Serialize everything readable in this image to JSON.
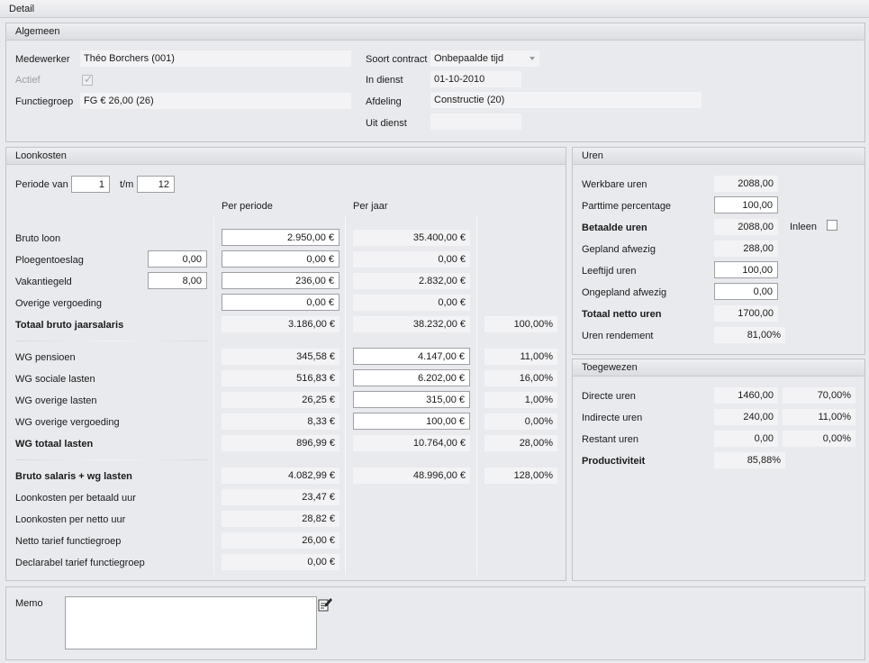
{
  "window": {
    "title": "Detail"
  },
  "algemeen": {
    "title": "Algemeen",
    "medewerker_label": "Medewerker",
    "medewerker_value": "Théo Borchers (001)",
    "actief_label": "Actief",
    "functiegroep_label": "Functiegroep",
    "functiegroep_value": "FG € 26,00 (26)",
    "soort_contract_label": "Soort contract",
    "soort_contract_value": "Onbepaalde tijd",
    "in_dienst_label": "In dienst",
    "in_dienst_value": "01-10-2010",
    "afdeling_label": "Afdeling",
    "afdeling_value": "Constructie (20)",
    "uit_dienst_label": "Uit dienst",
    "uit_dienst_value": ""
  },
  "loonkosten": {
    "title": "Loonkosten",
    "periode_van_label": "Periode van",
    "periode_van_value": "1",
    "tm_label": "t/m",
    "tm_value": "12",
    "col_per_periode": "Per periode",
    "col_per_jaar": "Per jaar",
    "bruto_loon": {
      "label": "Bruto loon",
      "periode": "2.950,00 €",
      "jaar": "35.400,00 €"
    },
    "ploegentoeslag": {
      "label": "Ploegentoeslag",
      "pct": "0,00",
      "periode": "0,00 €",
      "jaar": "0,00 €"
    },
    "vakantiegeld": {
      "label": "Vakantiegeld",
      "pct": "8,00",
      "periode": "236,00 €",
      "jaar": "2.832,00 €"
    },
    "overige_vergoeding": {
      "label": "Overige vergoeding",
      "periode": "0,00 €",
      "jaar": "0,00 €"
    },
    "totaal_bruto": {
      "label": "Totaal bruto jaarsalaris",
      "periode": "3.186,00 €",
      "jaar": "38.232,00 €",
      "pct": "100,00%"
    },
    "wg_pensioen": {
      "label": "WG pensioen",
      "periode": "345,58 €",
      "jaar": "4.147,00 €",
      "pct": "11,00%"
    },
    "wg_sociale": {
      "label": "WG sociale lasten",
      "periode": "516,83 €",
      "jaar": "6.202,00 €",
      "pct": "16,00%"
    },
    "wg_overige_lasten": {
      "label": "WG overige lasten",
      "periode": "26,25 €",
      "jaar": "315,00 €",
      "pct": "1,00%"
    },
    "wg_overige_verg": {
      "label": "WG overige vergoeding",
      "periode": "8,33 €",
      "jaar": "100,00 €",
      "pct": "0,00%"
    },
    "wg_totaal": {
      "label": "WG totaal lasten",
      "periode": "896,99 €",
      "jaar": "10.764,00 €",
      "pct": "28,00%"
    },
    "bruto_plus_wg": {
      "label": "Bruto salaris + wg lasten",
      "periode": "4.082,99 €",
      "jaar": "48.996,00 €",
      "pct": "128,00%"
    },
    "lk_betaald_uur": {
      "label": "Loonkosten per betaald uur",
      "periode": "23,47 €"
    },
    "lk_netto_uur": {
      "label": "Loonkosten per netto uur",
      "periode": "28,82 €"
    },
    "netto_tarief": {
      "label": "Netto tarief functiegroep",
      "periode": "26,00 €"
    },
    "declarabel_tarief": {
      "label": "Declarabel tarief functiegroep",
      "periode": "0,00 €"
    }
  },
  "uren": {
    "title": "Uren",
    "werkbare": {
      "label": "Werkbare uren",
      "value": "2088,00"
    },
    "parttime": {
      "label": "Parttime percentage",
      "value": "100,00"
    },
    "betaalde": {
      "label": "Betaalde uren",
      "value": "2088,00"
    },
    "inleen_label": "Inleen",
    "gepland": {
      "label": "Gepland afwezig",
      "value": "288,00"
    },
    "leeftijd": {
      "label": "Leeftijd uren",
      "value": "100,00"
    },
    "ongepland": {
      "label": "Ongepland afwezig",
      "value": "0,00"
    },
    "totaal_netto": {
      "label": "Totaal netto uren",
      "value": "1700,00"
    },
    "rendement": {
      "label": "Uren rendement",
      "value": "81,00%"
    }
  },
  "toegewezen": {
    "title": "Toegewezen",
    "directe": {
      "label": "Directe uren",
      "value": "1460,00",
      "pct": "70,00%"
    },
    "indirecte": {
      "label": "Indirecte uren",
      "value": "240,00",
      "pct": "11,00%"
    },
    "restant": {
      "label": "Restant uren",
      "value": "0,00",
      "pct": "0,00%"
    },
    "productiviteit": {
      "label": "Productiviteit",
      "value": "85,88%"
    }
  },
  "memo": {
    "label": "Memo",
    "value": ""
  }
}
